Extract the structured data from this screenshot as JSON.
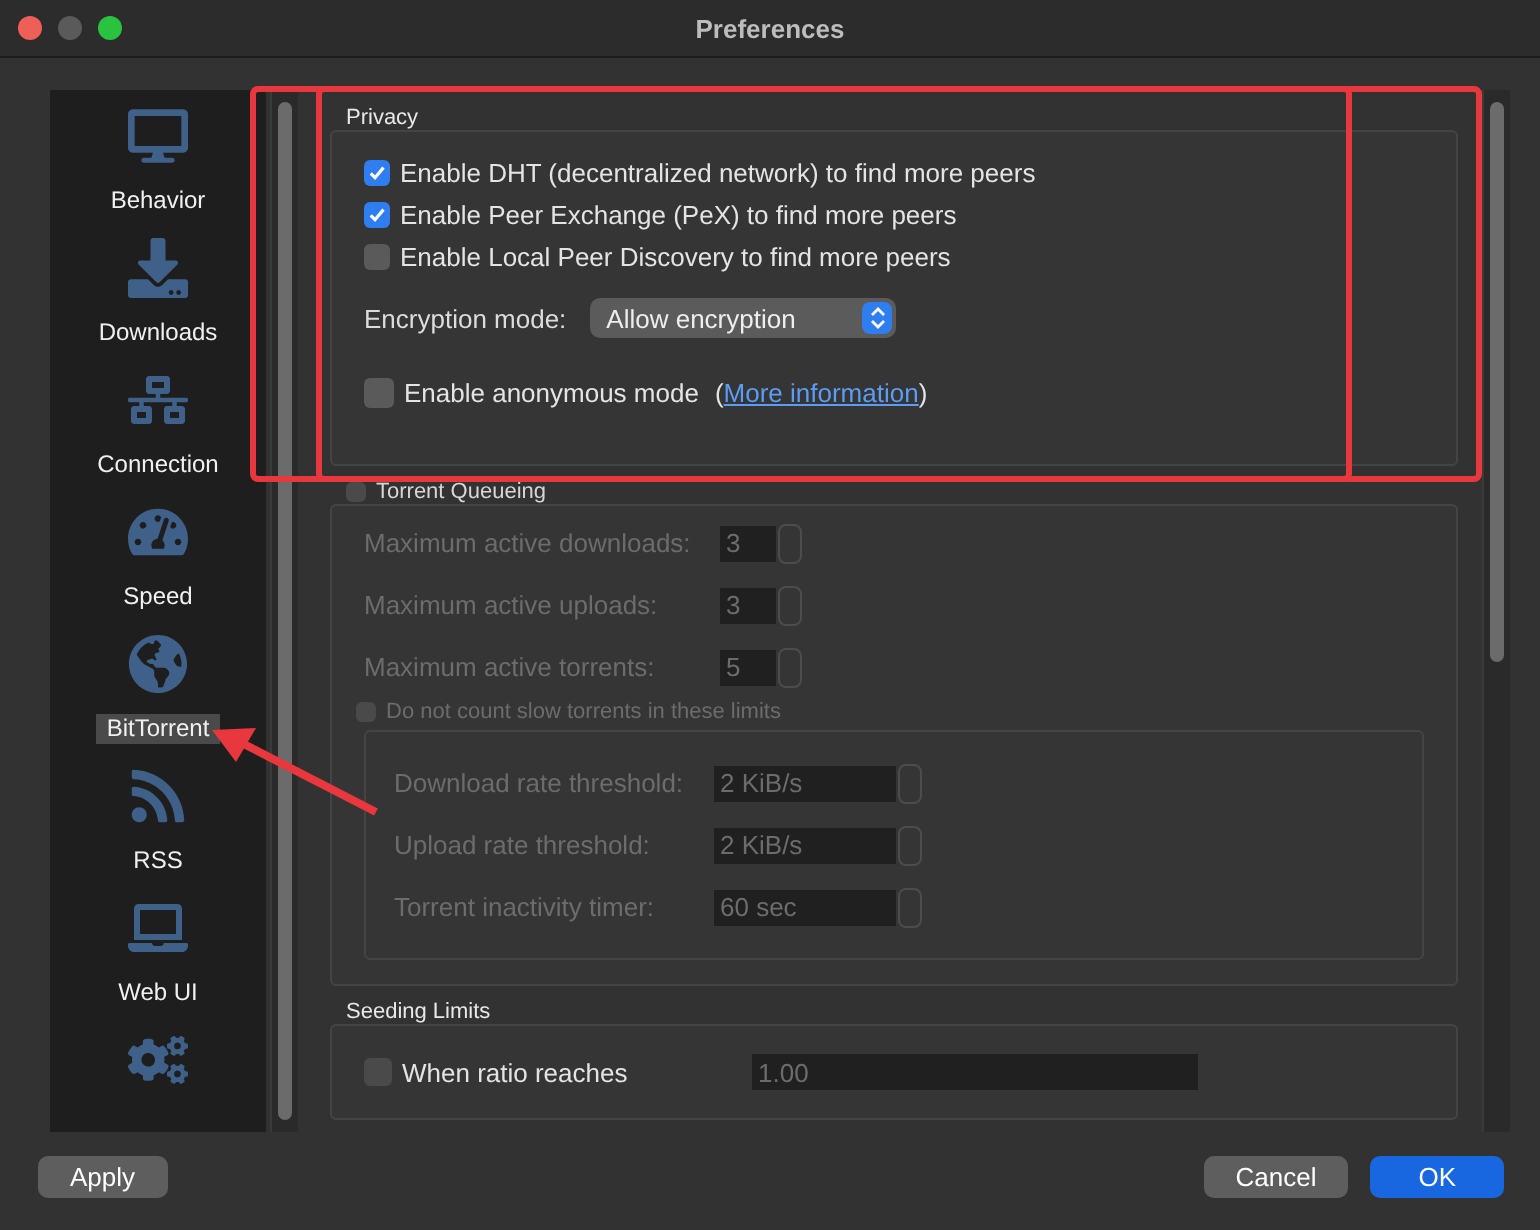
{
  "window": {
    "title": "Preferences"
  },
  "sidebar": {
    "items": [
      {
        "kind": "behavior",
        "label": "Behavior",
        "selected": false
      },
      {
        "kind": "downloads",
        "label": "Downloads",
        "selected": false
      },
      {
        "kind": "connection",
        "label": "Connection",
        "selected": false
      },
      {
        "kind": "speed",
        "label": "Speed",
        "selected": false
      },
      {
        "kind": "bittorrent",
        "label": "BitTorrent",
        "selected": true
      },
      {
        "kind": "rss",
        "label": "RSS",
        "selected": false
      },
      {
        "kind": "webui",
        "label": "Web UI",
        "selected": false
      },
      {
        "kind": "advanced",
        "selected": false
      }
    ]
  },
  "privacy": {
    "title": "Privacy",
    "options": [
      {
        "label": "Enable DHT (decentralized network) to find more peers",
        "checked": true
      },
      {
        "label": "Enable Peer Exchange (PeX) to find more peers",
        "checked": true
      },
      {
        "label": "Enable Local Peer Discovery to find more peers",
        "checked": false
      }
    ],
    "encryption": {
      "label": "Encryption mode:",
      "value": "Allow encryption"
    },
    "anonymous": {
      "label": "Enable anonymous mode",
      "checked": false,
      "link_before": "(",
      "link": "More information",
      "link_after": ")"
    }
  },
  "queueing": {
    "title": "Torrent Queueing",
    "checked": false,
    "disabled": true,
    "fields": [
      {
        "label": "Maximum active downloads:",
        "value": "3"
      },
      {
        "label": "Maximum active uploads:",
        "value": "3"
      },
      {
        "label": "Maximum active torrents:",
        "value": "5"
      }
    ],
    "slow": {
      "label": "Do not count slow torrents in these limits",
      "checked": false
    },
    "thresholds": [
      {
        "label": "Download rate threshold:",
        "value": "2 KiB/s"
      },
      {
        "label": "Upload rate threshold:",
        "value": "2 KiB/s"
      },
      {
        "label": "Torrent inactivity timer:",
        "value": "60 sec"
      }
    ]
  },
  "seeding": {
    "title": "Seeding Limits",
    "ratio": {
      "label": "When ratio reaches",
      "checked": false,
      "disabled": true,
      "value": "1.00"
    }
  },
  "buttons": [
    {
      "label": "Apply",
      "kind": "plain"
    },
    {
      "label": "Cancel",
      "kind": "plain"
    },
    {
      "label": "OK",
      "kind": "primary"
    }
  ]
}
